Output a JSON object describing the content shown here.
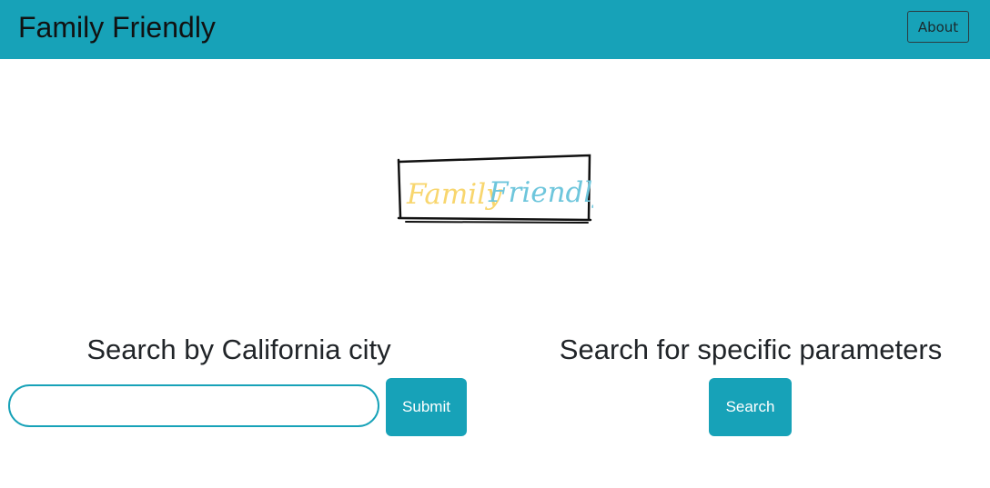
{
  "navbar": {
    "brand": "Family Friendly",
    "about_label": "About"
  },
  "logo": {
    "word1": "Family",
    "word2": "Friendly",
    "colors": {
      "word1": "#f8d66e",
      "word2": "#6ec6dc",
      "frame": "#111111"
    }
  },
  "city_search": {
    "heading": "Search by California city",
    "input_value": "",
    "submit_label": "Submit"
  },
  "param_search": {
    "heading": "Search for specific parameters",
    "search_label": "Search"
  },
  "colors": {
    "accent": "#17a2b8"
  }
}
